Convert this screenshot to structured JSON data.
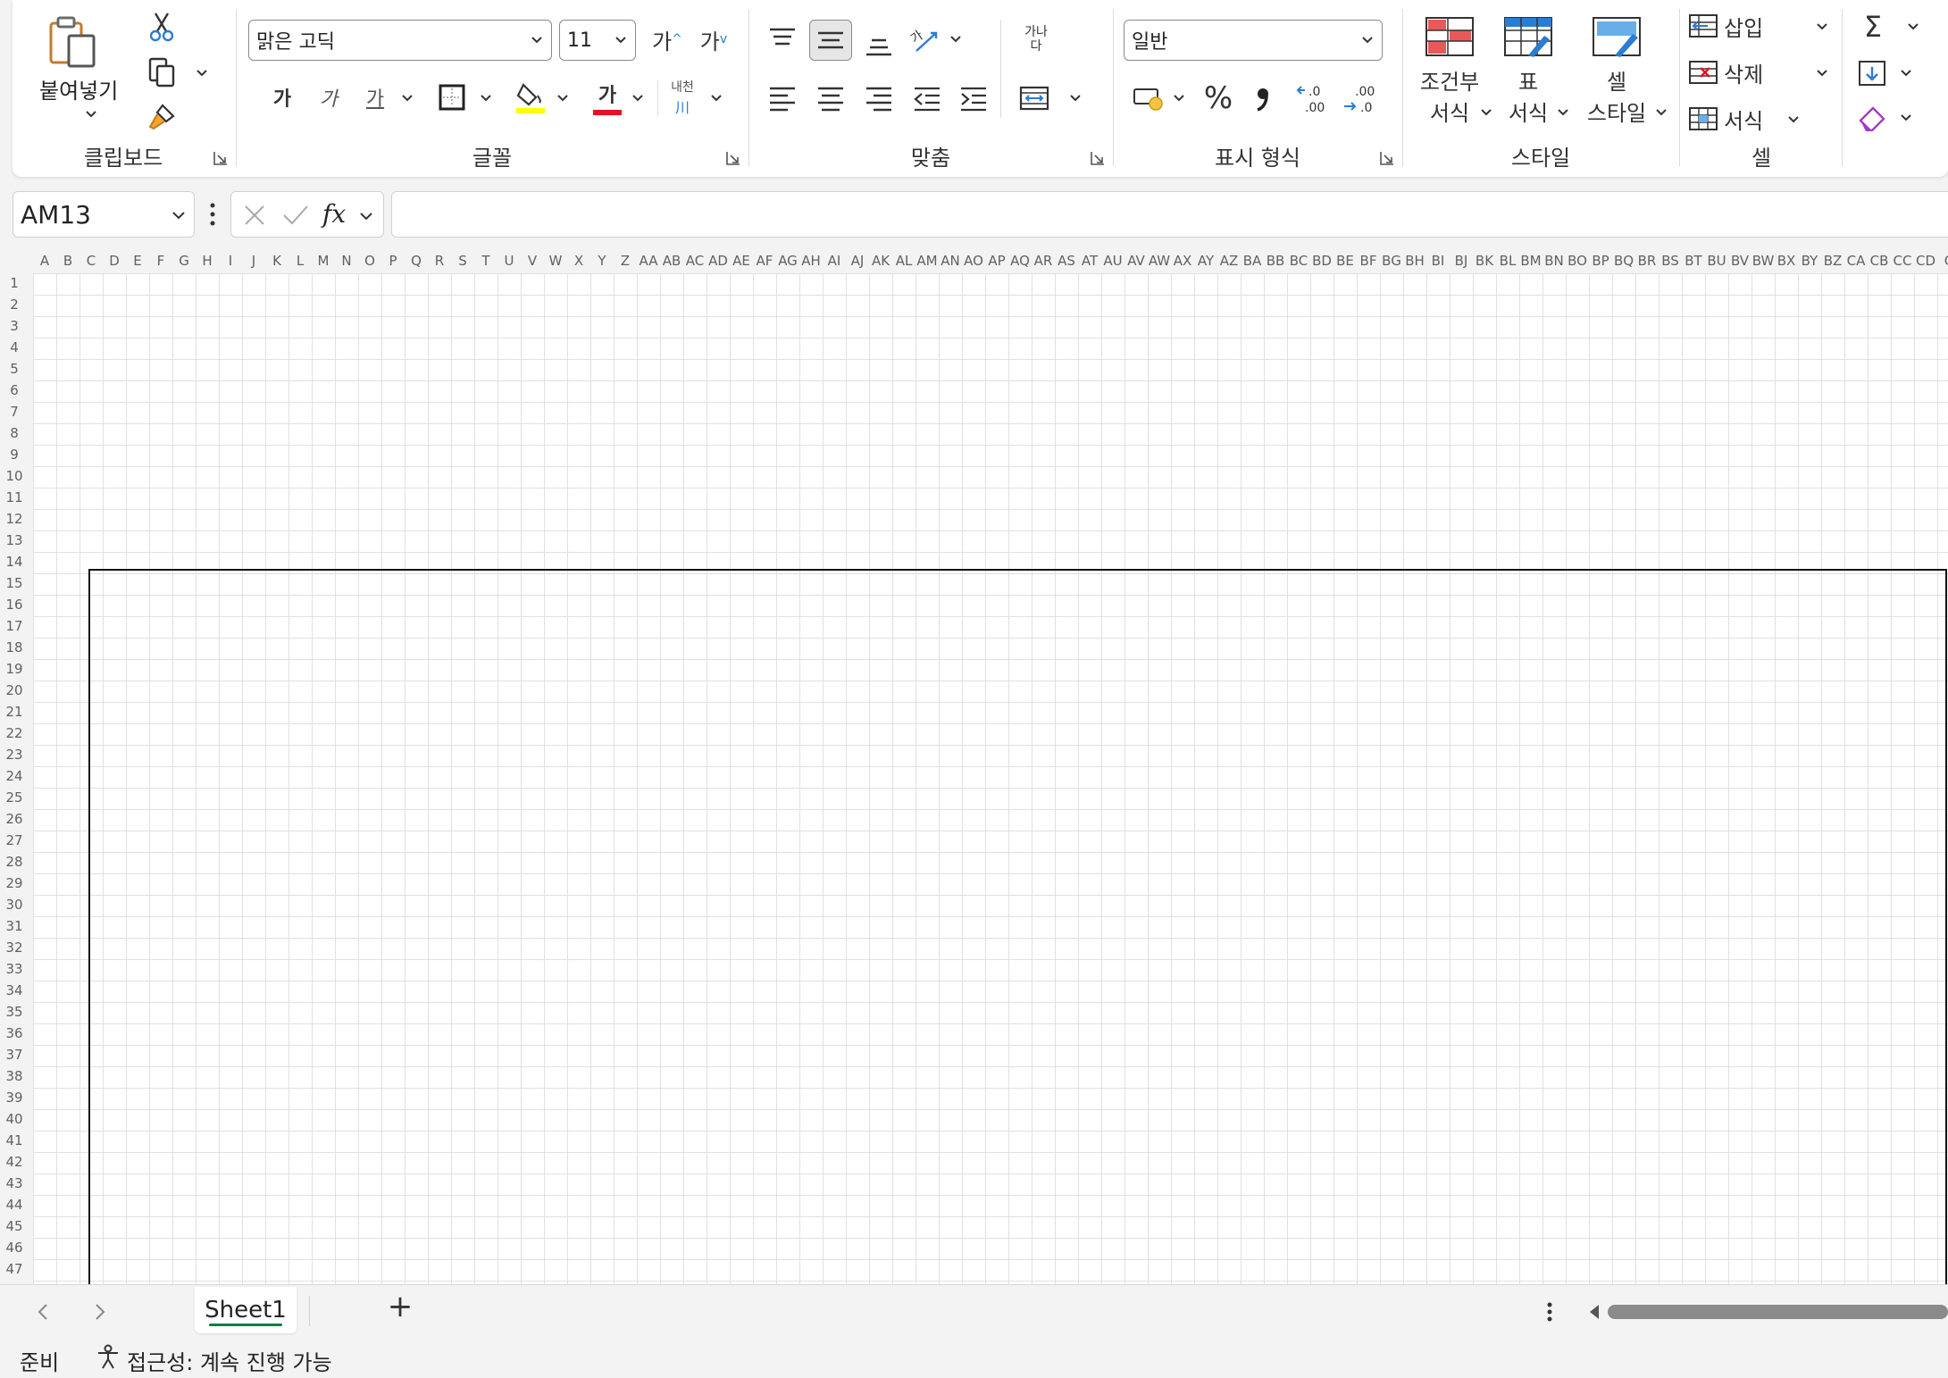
{
  "ribbon": {
    "clipboard": {
      "paste_label": "붙여넣기",
      "group_label": "클립보드"
    },
    "font": {
      "font_name": "맑은 고딕",
      "font_size": "11",
      "grow_label": "가",
      "shrink_label": "가",
      "bold_label": "가",
      "italic_label": "가",
      "underline_label": "가",
      "font_color_label": "가",
      "phonetic_top": "내천",
      "phonetic_bottom": "川",
      "highlight_color": "#ffff00",
      "font_color": "#e81123",
      "group_label": "글꼴"
    },
    "alignment": {
      "wrap_label_top": "가나",
      "wrap_label_bottom": "다",
      "orientation_label": "가",
      "group_label": "맞춤"
    },
    "number": {
      "format_value": "일반",
      "percent_label": "%",
      "comma_label": "9",
      "inc_decimal_label": ".0\n.00",
      "dec_decimal_label": ".00\n→.0",
      "group_label": "표시 형식"
    },
    "styles": {
      "conditional_line1": "조건부",
      "conditional_line2": "서식",
      "table_line1": "표",
      "table_line2": "서식",
      "cell_line1": "셀",
      "cell_line2": "스타일",
      "group_label": "스타일"
    },
    "cells": {
      "insert_label": "삽입",
      "delete_label": "삭제",
      "format_label": "서식",
      "group_label": "셀"
    },
    "editing": {
      "sum_symbol": "Σ"
    }
  },
  "formula_bar": {
    "name_box": "AM13",
    "fx_label": "fx",
    "formula": ""
  },
  "grid": {
    "columns": [
      "A",
      "B",
      "C",
      "D",
      "E",
      "F",
      "G",
      "H",
      "I",
      "J",
      "K",
      "L",
      "M",
      "N",
      "O",
      "P",
      "Q",
      "R",
      "S",
      "T",
      "U",
      "V",
      "W",
      "X",
      "Y",
      "Z",
      "AA",
      "AB",
      "AC",
      "AD",
      "AE",
      "AF",
      "AG",
      "AH",
      "AI",
      "AJ",
      "AK",
      "AL",
      "AM",
      "AN",
      "AO",
      "AP",
      "AQ",
      "AR",
      "AS",
      "AT",
      "AU",
      "AV",
      "AW",
      "AX",
      "AY",
      "AZ",
      "BA",
      "BB",
      "BC",
      "BD",
      "BE",
      "BF",
      "BG",
      "BH",
      "BI",
      "BJ",
      "BK",
      "BL",
      "BM",
      "BN",
      "BO",
      "BP",
      "BQ",
      "BR",
      "BS",
      "BT",
      "BU",
      "BV",
      "BW",
      "BX",
      "BY",
      "BZ",
      "CA",
      "CB",
      "CC",
      "CD",
      "C"
    ],
    "rows": [
      "1",
      "2",
      "3",
      "4",
      "5",
      "6",
      "7",
      "8",
      "9",
      "10",
      "11",
      "12",
      "13",
      "14",
      "15",
      "16",
      "17",
      "18",
      "19",
      "20",
      "21",
      "22",
      "23",
      "24",
      "25",
      "26",
      "27",
      "28",
      "29",
      "30",
      "31",
      "32",
      "33",
      "34",
      "35",
      "36",
      "37",
      "38",
      "39",
      "40",
      "41",
      "42",
      "43",
      "44",
      "45",
      "46",
      "47"
    ]
  },
  "sheets": {
    "tabs": [
      "Sheet1"
    ],
    "active": "Sheet1",
    "add_label": "+"
  },
  "status": {
    "ready": "준비",
    "accessibility": "접근성: 계속 진행 가능"
  },
  "colors": {
    "accent_green": "#107c41",
    "icon_blue": "#2b7cd3"
  }
}
